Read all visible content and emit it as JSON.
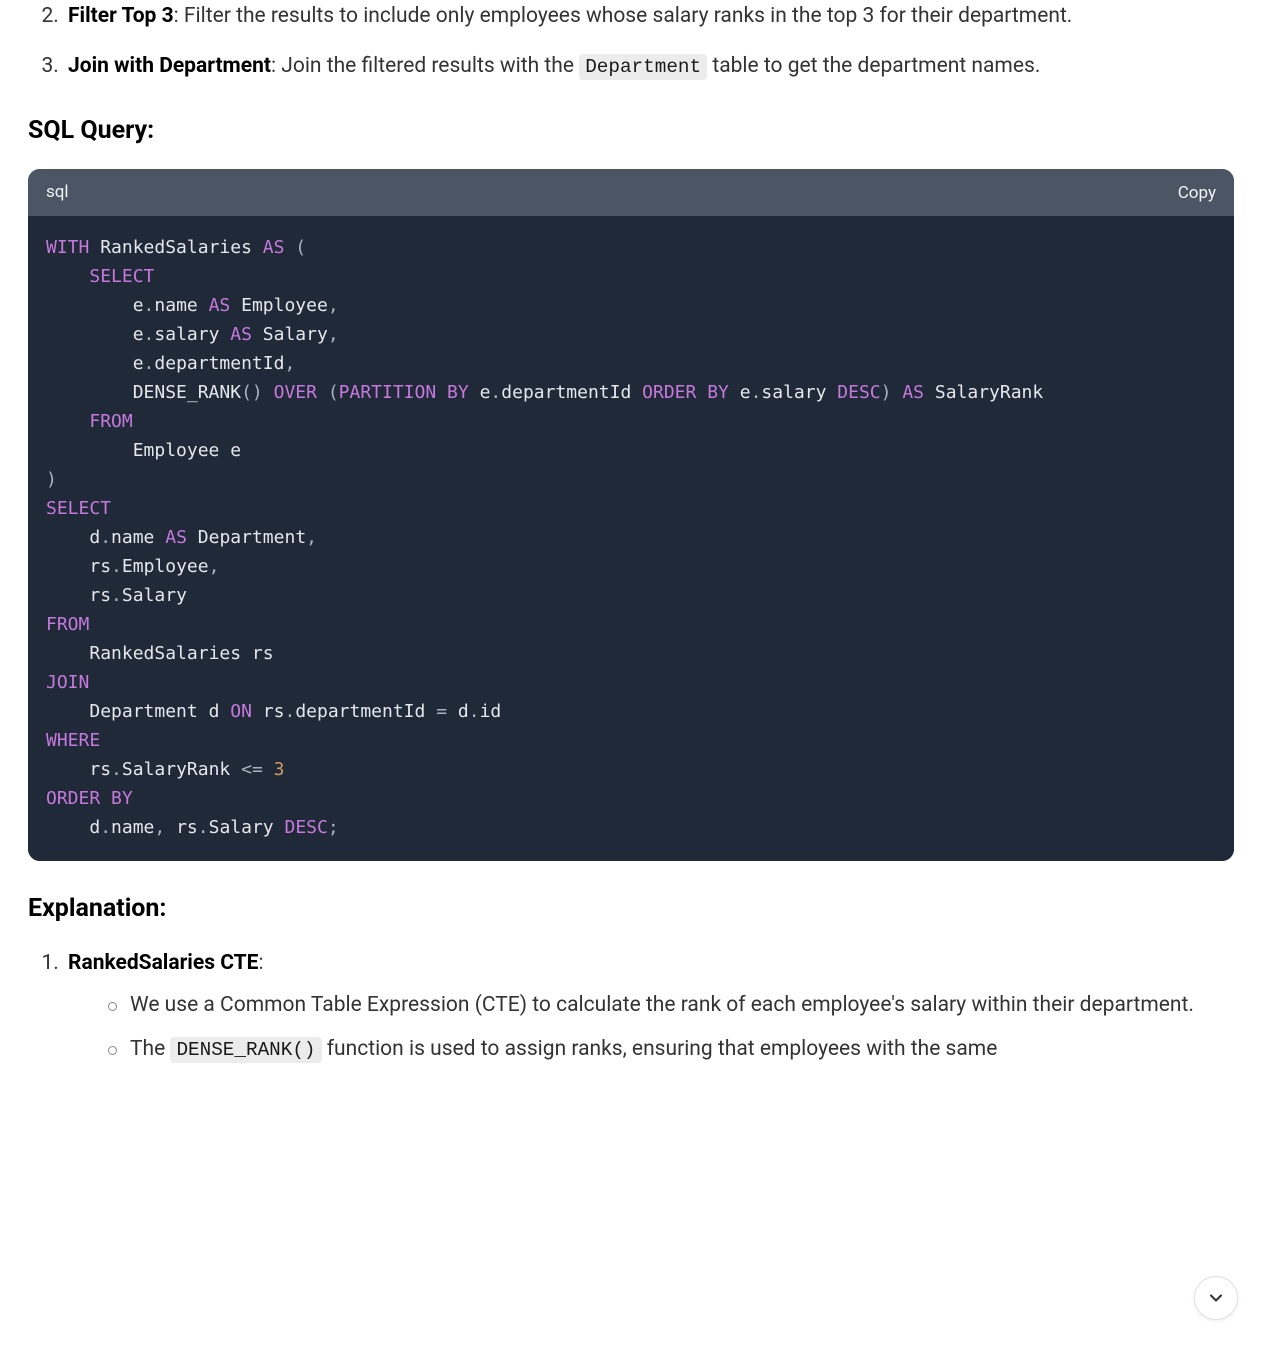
{
  "steps": [
    {
      "num": "2.",
      "bold": "Filter Top 3",
      "rest": ": Filter the results to include only employees whose salary ranks in the top 3 for their department."
    },
    {
      "num": "3.",
      "bold": "Join with Department",
      "prefix": ": Join the filtered results with the ",
      "code": "Department",
      "suffix": " table to get the department names."
    }
  ],
  "section_sql": "SQL Query:",
  "code_lang": "sql",
  "copy_label": "Copy",
  "tokens": [
    [
      "kw",
      "WITH"
    ],
    [
      "sp",
      " "
    ],
    [
      "id",
      "RankedSalaries"
    ],
    [
      "sp",
      " "
    ],
    [
      "kw",
      "AS"
    ],
    [
      "sp",
      " "
    ],
    [
      "punc",
      "("
    ],
    [
      "nl"
    ],
    [
      "sp",
      "    "
    ],
    [
      "kw",
      "SELECT"
    ],
    [
      "nl"
    ],
    [
      "sp",
      "        "
    ],
    [
      "id",
      "e"
    ],
    [
      "punc",
      "."
    ],
    [
      "id",
      "name"
    ],
    [
      "sp",
      " "
    ],
    [
      "kw",
      "AS"
    ],
    [
      "sp",
      " "
    ],
    [
      "id",
      "Employee"
    ],
    [
      "punc",
      ","
    ],
    [
      "nl"
    ],
    [
      "sp",
      "        "
    ],
    [
      "id",
      "e"
    ],
    [
      "punc",
      "."
    ],
    [
      "id",
      "salary"
    ],
    [
      "sp",
      " "
    ],
    [
      "kw",
      "AS"
    ],
    [
      "sp",
      " "
    ],
    [
      "id",
      "Salary"
    ],
    [
      "punc",
      ","
    ],
    [
      "nl"
    ],
    [
      "sp",
      "        "
    ],
    [
      "id",
      "e"
    ],
    [
      "punc",
      "."
    ],
    [
      "id",
      "departmentId"
    ],
    [
      "punc",
      ","
    ],
    [
      "nl"
    ],
    [
      "sp",
      "        "
    ],
    [
      "id",
      "DENSE_RANK"
    ],
    [
      "punc",
      "()"
    ],
    [
      "sp",
      " "
    ],
    [
      "kw",
      "OVER"
    ],
    [
      "sp",
      " "
    ],
    [
      "punc",
      "("
    ],
    [
      "kw",
      "PARTITION"
    ],
    [
      "sp",
      " "
    ],
    [
      "kw",
      "BY"
    ],
    [
      "sp",
      " "
    ],
    [
      "id",
      "e"
    ],
    [
      "punc",
      "."
    ],
    [
      "id",
      "departmentId"
    ],
    [
      "sp",
      " "
    ],
    [
      "kw",
      "ORDER"
    ],
    [
      "sp",
      " "
    ],
    [
      "kw",
      "BY"
    ],
    [
      "sp",
      " "
    ],
    [
      "id",
      "e"
    ],
    [
      "punc",
      "."
    ],
    [
      "id",
      "salary"
    ],
    [
      "sp",
      " "
    ],
    [
      "kw",
      "DESC"
    ],
    [
      "punc",
      ")"
    ],
    [
      "sp",
      " "
    ],
    [
      "kw",
      "AS"
    ],
    [
      "sp",
      " "
    ],
    [
      "id",
      "SalaryRank"
    ],
    [
      "nl"
    ],
    [
      "sp",
      "    "
    ],
    [
      "kw",
      "FROM"
    ],
    [
      "nl"
    ],
    [
      "sp",
      "        "
    ],
    [
      "id",
      "Employee e"
    ],
    [
      "nl"
    ],
    [
      "punc",
      ")"
    ],
    [
      "nl"
    ],
    [
      "kw",
      "SELECT"
    ],
    [
      "nl"
    ],
    [
      "sp",
      "    "
    ],
    [
      "id",
      "d"
    ],
    [
      "punc",
      "."
    ],
    [
      "id",
      "name"
    ],
    [
      "sp",
      " "
    ],
    [
      "kw",
      "AS"
    ],
    [
      "sp",
      " "
    ],
    [
      "id",
      "Department"
    ],
    [
      "punc",
      ","
    ],
    [
      "nl"
    ],
    [
      "sp",
      "    "
    ],
    [
      "id",
      "rs"
    ],
    [
      "punc",
      "."
    ],
    [
      "id",
      "Employee"
    ],
    [
      "punc",
      ","
    ],
    [
      "nl"
    ],
    [
      "sp",
      "    "
    ],
    [
      "id",
      "rs"
    ],
    [
      "punc",
      "."
    ],
    [
      "id",
      "Salary"
    ],
    [
      "nl"
    ],
    [
      "kw",
      "FROM"
    ],
    [
      "nl"
    ],
    [
      "sp",
      "    "
    ],
    [
      "id",
      "RankedSalaries rs"
    ],
    [
      "nl"
    ],
    [
      "kw",
      "JOIN"
    ],
    [
      "nl"
    ],
    [
      "sp",
      "    "
    ],
    [
      "id",
      "Department d"
    ],
    [
      "sp",
      " "
    ],
    [
      "kw",
      "ON"
    ],
    [
      "sp",
      " "
    ],
    [
      "id",
      "rs"
    ],
    [
      "punc",
      "."
    ],
    [
      "id",
      "departmentId"
    ],
    [
      "sp",
      " "
    ],
    [
      "punc",
      "="
    ],
    [
      "sp",
      " "
    ],
    [
      "id",
      "d"
    ],
    [
      "punc",
      "."
    ],
    [
      "id",
      "id"
    ],
    [
      "nl"
    ],
    [
      "kw",
      "WHERE"
    ],
    [
      "nl"
    ],
    [
      "sp",
      "    "
    ],
    [
      "id",
      "rs"
    ],
    [
      "punc",
      "."
    ],
    [
      "id",
      "SalaryRank"
    ],
    [
      "sp",
      " "
    ],
    [
      "punc",
      "<="
    ],
    [
      "sp",
      " "
    ],
    [
      "num",
      "3"
    ],
    [
      "nl"
    ],
    [
      "kw",
      "ORDER"
    ],
    [
      "sp",
      " "
    ],
    [
      "kw",
      "BY"
    ],
    [
      "nl"
    ],
    [
      "sp",
      "    "
    ],
    [
      "id",
      "d"
    ],
    [
      "punc",
      "."
    ],
    [
      "id",
      "name"
    ],
    [
      "punc",
      ","
    ],
    [
      "sp",
      " "
    ],
    [
      "id",
      "rs"
    ],
    [
      "punc",
      "."
    ],
    [
      "id",
      "Salary"
    ],
    [
      "sp",
      " "
    ],
    [
      "kw",
      "DESC"
    ],
    [
      "punc",
      ";"
    ]
  ],
  "section_explanation": "Explanation:",
  "explanation": {
    "item1_num": "1.",
    "item1_bold": "RankedSalaries CTE",
    "item1_colon": ":",
    "sub1": "We use a Common Table Expression (CTE) to calculate the rank of each employee's salary within their department.",
    "sub2_prefix": "The ",
    "sub2_code": "DENSE_RANK()",
    "sub2_suffix": " function is used to assign ranks, ensuring that employees with the same"
  }
}
